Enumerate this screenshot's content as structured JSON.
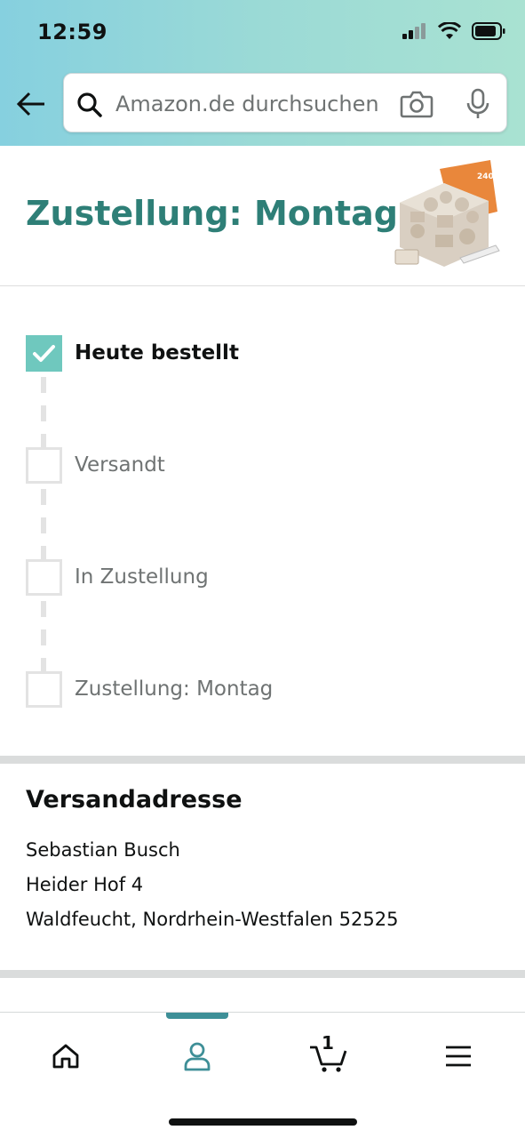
{
  "status_bar": {
    "time": "12:59"
  },
  "search": {
    "placeholder": "Amazon.de durchsuchen"
  },
  "page": {
    "title": "Zustellung: Montag"
  },
  "tracking": {
    "steps": [
      {
        "label": "Heute bestellt",
        "done": true
      },
      {
        "label": "Versandt",
        "done": false
      },
      {
        "label": "In Zustellung",
        "done": false
      },
      {
        "label": "Zustellung: Montag",
        "done": false
      }
    ]
  },
  "address": {
    "heading": "Versandadresse",
    "name": "Sebastian Busch",
    "street": "Heider Hof 4",
    "city": "Waldfeucht, Nordrhein-Westfalen 52525"
  },
  "product_image": {
    "badge": "240"
  },
  "bottom_nav": {
    "items": [
      {
        "icon": "home-icon"
      },
      {
        "icon": "account-icon",
        "active": true
      },
      {
        "icon": "cart-icon",
        "count": "1"
      },
      {
        "icon": "menu-icon"
      }
    ]
  },
  "colors": {
    "accent": "#2e7f77",
    "check": "#6fc8be",
    "nav_active": "#3e8f97"
  }
}
